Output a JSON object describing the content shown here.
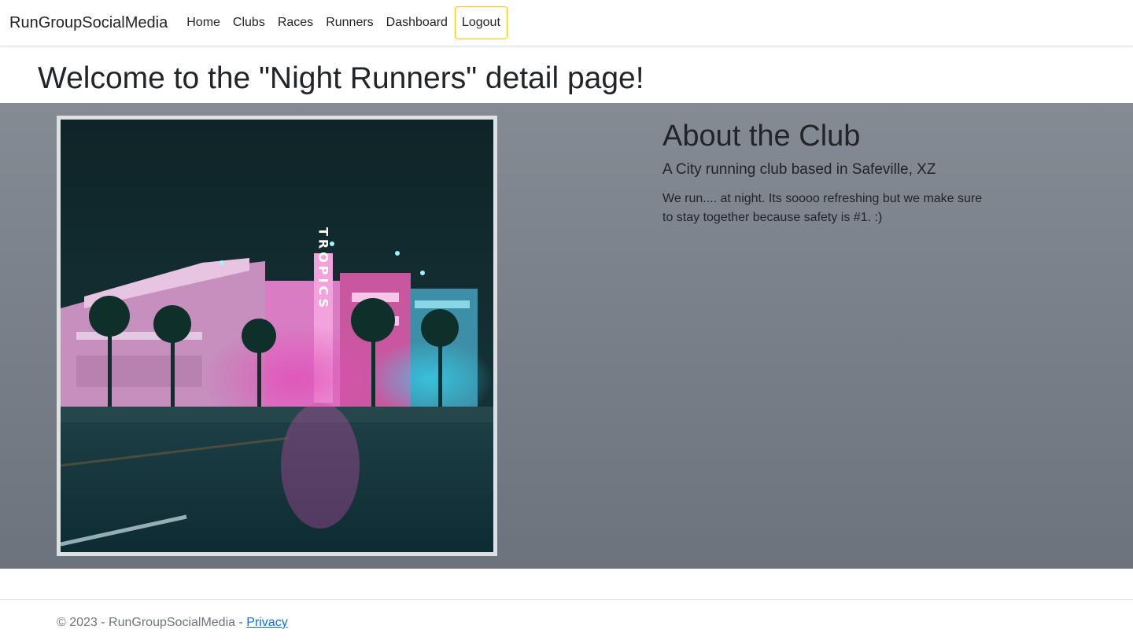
{
  "navbar": {
    "brand": "RunGroupSocialMedia",
    "links": [
      "Home",
      "Clubs",
      "Races",
      "Runners",
      "Dashboard"
    ],
    "logout_label": "Logout"
  },
  "page": {
    "title": "Welcome to the \"Night Runners\" detail page!"
  },
  "about": {
    "heading": "About the Club",
    "lead": "A City running club based in Safeville, XZ",
    "description": "We run.... at night. Its soooo refreshing but we make sure to stay together because safety is #1. :)"
  },
  "image": {
    "sign_text": "TROPICS"
  },
  "footer": {
    "copyright": "© 2023 - RunGroupSocialMedia - ",
    "privacy_label": "Privacy"
  },
  "colors": {
    "logout_border": "#ffc107",
    "hero_top": "#858b93",
    "hero_bottom": "#6c737d",
    "link": "#0d6efd"
  }
}
